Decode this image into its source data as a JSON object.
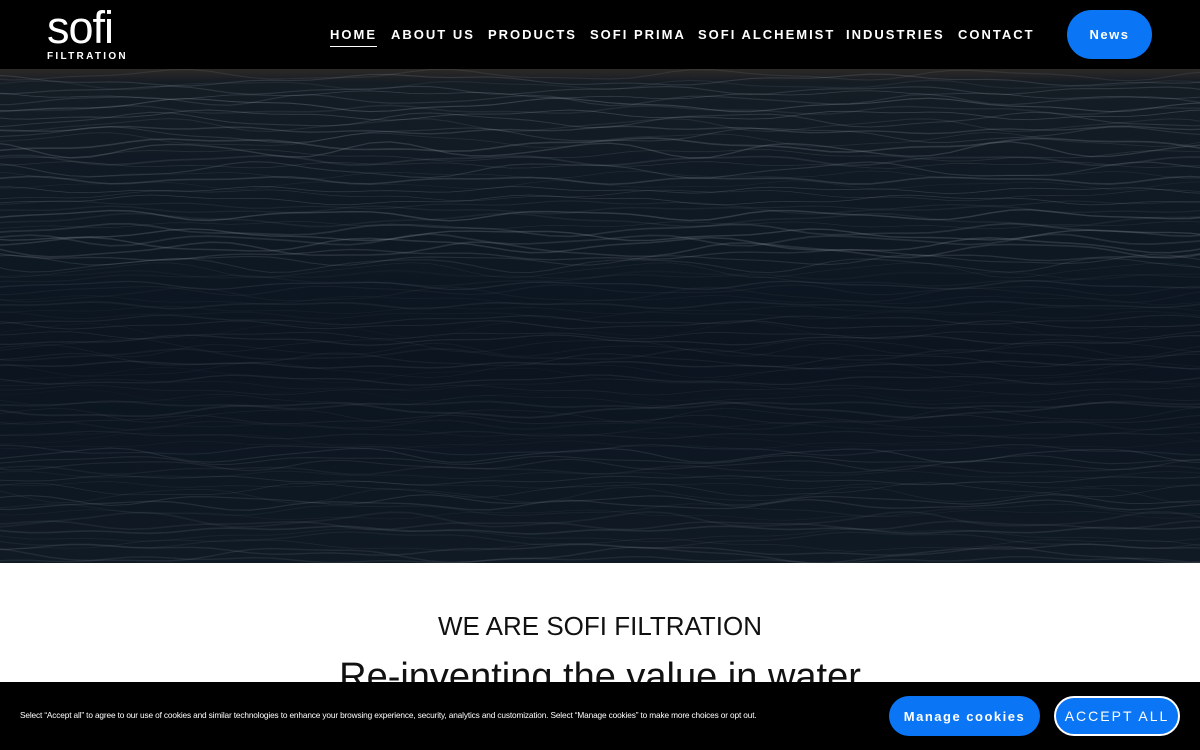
{
  "brand": {
    "logo_word": "sofi",
    "logo_sub": "FILTRATION"
  },
  "nav": {
    "items": [
      {
        "label": "HOME",
        "active": true
      },
      {
        "label": "ABOUT US"
      },
      {
        "label": "PRODUCTS"
      },
      {
        "label": "SOFI PRIMA"
      },
      {
        "label": "SOFI ALCHEMIST"
      },
      {
        "label": "INDUSTRIES"
      },
      {
        "label": "CONTACT"
      }
    ],
    "news_label": "News"
  },
  "intro": {
    "kicker": "WE ARE SOFI FILTRATION",
    "headline": "Re-inventing the value in water"
  },
  "cookie_banner": {
    "text": "Select “Accept all” to agree to our use of cookies and similar technologies to enhance your browsing experience, security, analytics and customization. Select “Manage cookies” to make more choices or opt out.",
    "manage_label": "Manage cookies",
    "accept_label": "ACCEPT ALL"
  },
  "colors": {
    "accent": "#0a75f5",
    "header_bg": "#000000",
    "hero_water": "#0c1622"
  }
}
